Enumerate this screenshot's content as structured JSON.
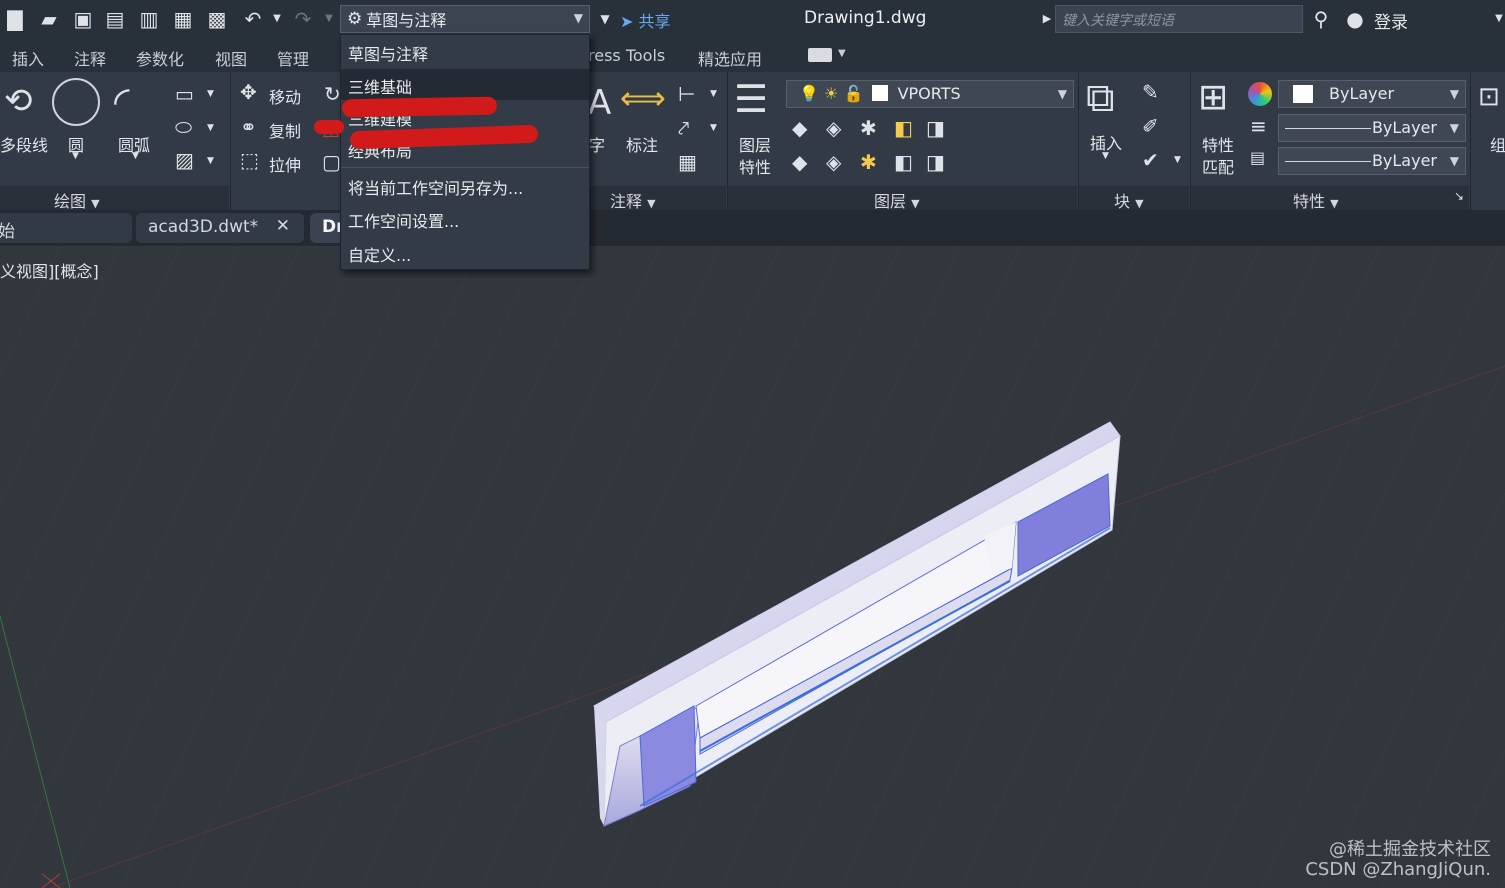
{
  "title_bar": {
    "workspace_label": "草图与注释",
    "share_label": "共享",
    "document_title": "Drawing1.dwg",
    "search_placeholder": "键入关键字或短语",
    "login_label": "登录"
  },
  "ribbon_tabs": [
    "插入",
    "注释",
    "参数化",
    "视图",
    "管理",
    "ress Tools",
    "精选应用"
  ],
  "draw_panel": {
    "polyline": "多段线",
    "circle": "圆",
    "arc": "圆弧",
    "title": "绘图"
  },
  "modify_panel": {
    "move": "移动",
    "copy": "复制",
    "stretch": "拉伸"
  },
  "annotation_panel": {
    "text_fragment": "字",
    "dimension": "标注",
    "title": "注释"
  },
  "layers_panel": {
    "properties_line1": "图层",
    "properties_line2": "特性",
    "current_layer": "VPORTS",
    "title": "图层"
  },
  "block_panel": {
    "insert": "插入",
    "title": "块"
  },
  "properties_panel": {
    "match_line1": "特性",
    "match_line2": "匹配",
    "color": "ByLayer",
    "linetype": "ByLayer",
    "lineweight": "ByLayer",
    "title": "特性",
    "group_fragment": "组"
  },
  "file_tabs": {
    "start_fragment": "始",
    "tab2": "acad3D.dwt*",
    "tab3_fragment": "Dr"
  },
  "viewport": {
    "view_label": "义视图][概念]",
    "watermark_line1": "@稀土掘金技术社区",
    "watermark_line2": "CSDN @ZhangJiQun."
  },
  "workspace_menu": {
    "items": [
      "草图与注释",
      "三维基础",
      "三维建模",
      "经典布局",
      "将当前工作空间另存为...",
      "工作空间设置...",
      "自定义..."
    ]
  },
  "colors": {
    "accent_blue": "#6aa7f0",
    "annotation_red": "#d21a1a",
    "model_face": "#7f7fd8"
  }
}
